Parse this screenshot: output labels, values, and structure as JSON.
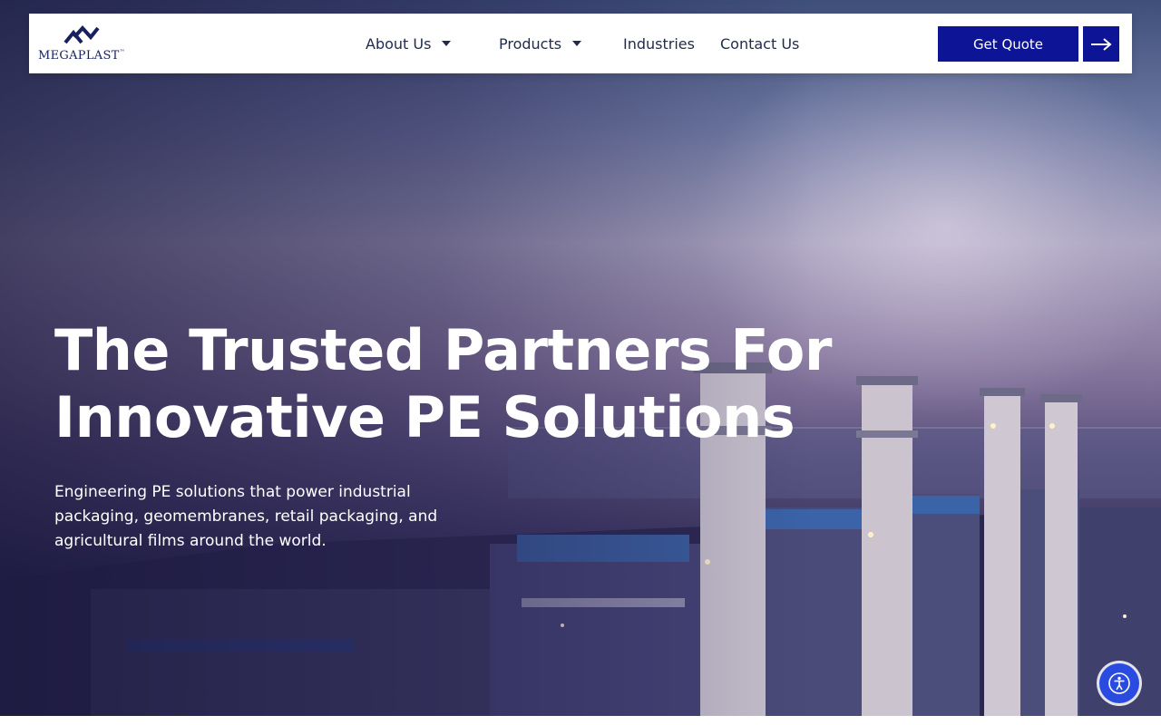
{
  "brand": {
    "name": "MEGAPLAST",
    "trademark": "™",
    "color": "#16205e"
  },
  "nav": {
    "items": [
      {
        "label": "About Us",
        "has_dropdown": true
      },
      {
        "label": "Products",
        "has_dropdown": true
      },
      {
        "label": "Industries",
        "has_dropdown": false
      },
      {
        "label": "Contact Us",
        "has_dropdown": false
      }
    ],
    "cta_label": "Get Quote",
    "cta_icon": "arrow-right-icon",
    "cta_color": "#0d1596"
  },
  "hero": {
    "headline_line1": "The Trusted Partners For",
    "headline_line2": "Innovative PE Solutions",
    "subtext": "Engineering PE solutions that power industrial packaging, geomembranes, retail packaging, and agricultural films around the world."
  },
  "accessibility": {
    "icon": "accessibility-icon",
    "color": "#2a4be0"
  }
}
